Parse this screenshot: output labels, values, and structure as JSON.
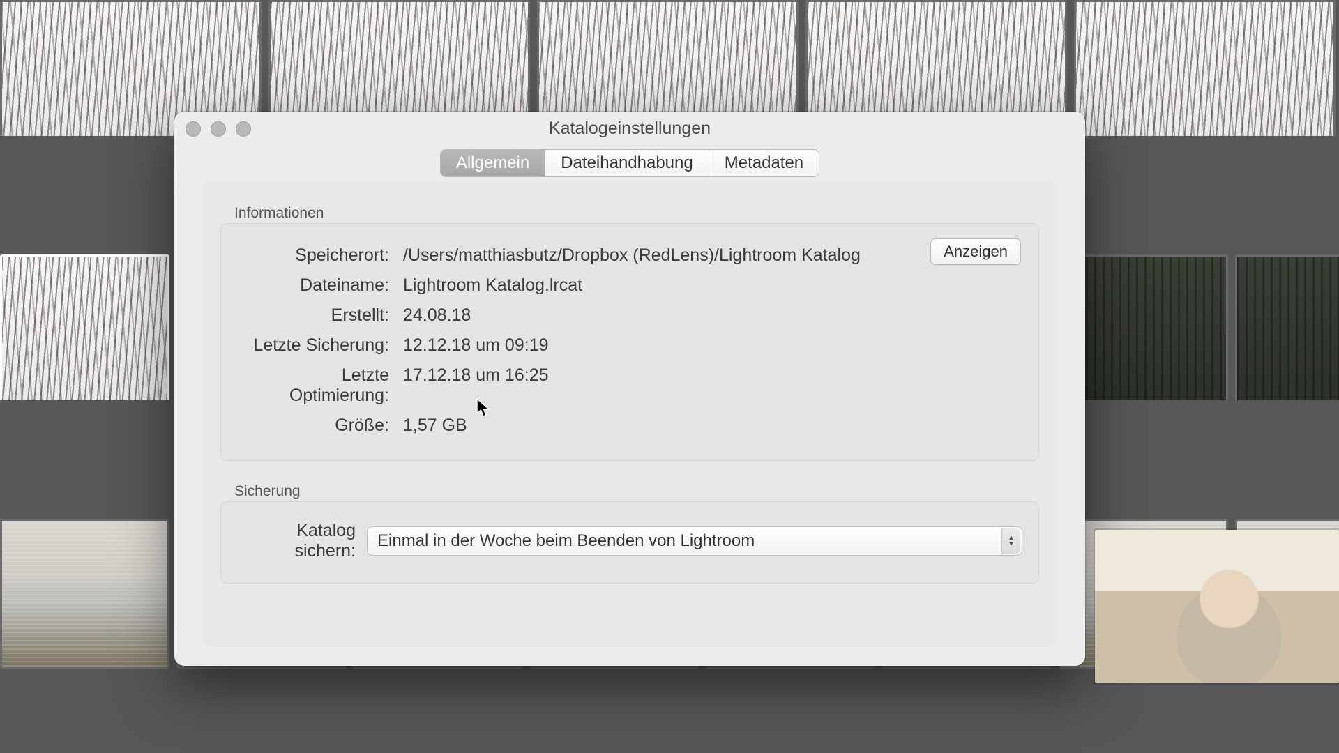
{
  "dialog": {
    "title": "Katalogeinstellungen",
    "tabs": [
      "Allgemein",
      "Dateihandhabung",
      "Metadaten"
    ],
    "active_tab": 0
  },
  "sections": {
    "info_label": "Informationen",
    "backup_label": "Sicherung"
  },
  "info": {
    "location_label": "Speicherort:",
    "location_value": "/Users/matthiasbutz/Dropbox (RedLens)/Lightroom Katalog",
    "filename_label": "Dateiname:",
    "filename_value": "Lightroom Katalog.lrcat",
    "created_label": "Erstellt:",
    "created_value": "24.08.18",
    "last_backup_label": "Letzte Sicherung:",
    "last_backup_value": "12.12.18 um 09:19",
    "last_optimize_label": "Letzte Optimierung:",
    "last_optimize_value": "17.12.18 um 16:25",
    "size_label": "Größe:",
    "size_value": "1,57 GB",
    "show_button": "Anzeigen"
  },
  "backup": {
    "label": "Katalog sichern:",
    "value": "Einmal in der Woche beim Beenden von Lightroom"
  }
}
